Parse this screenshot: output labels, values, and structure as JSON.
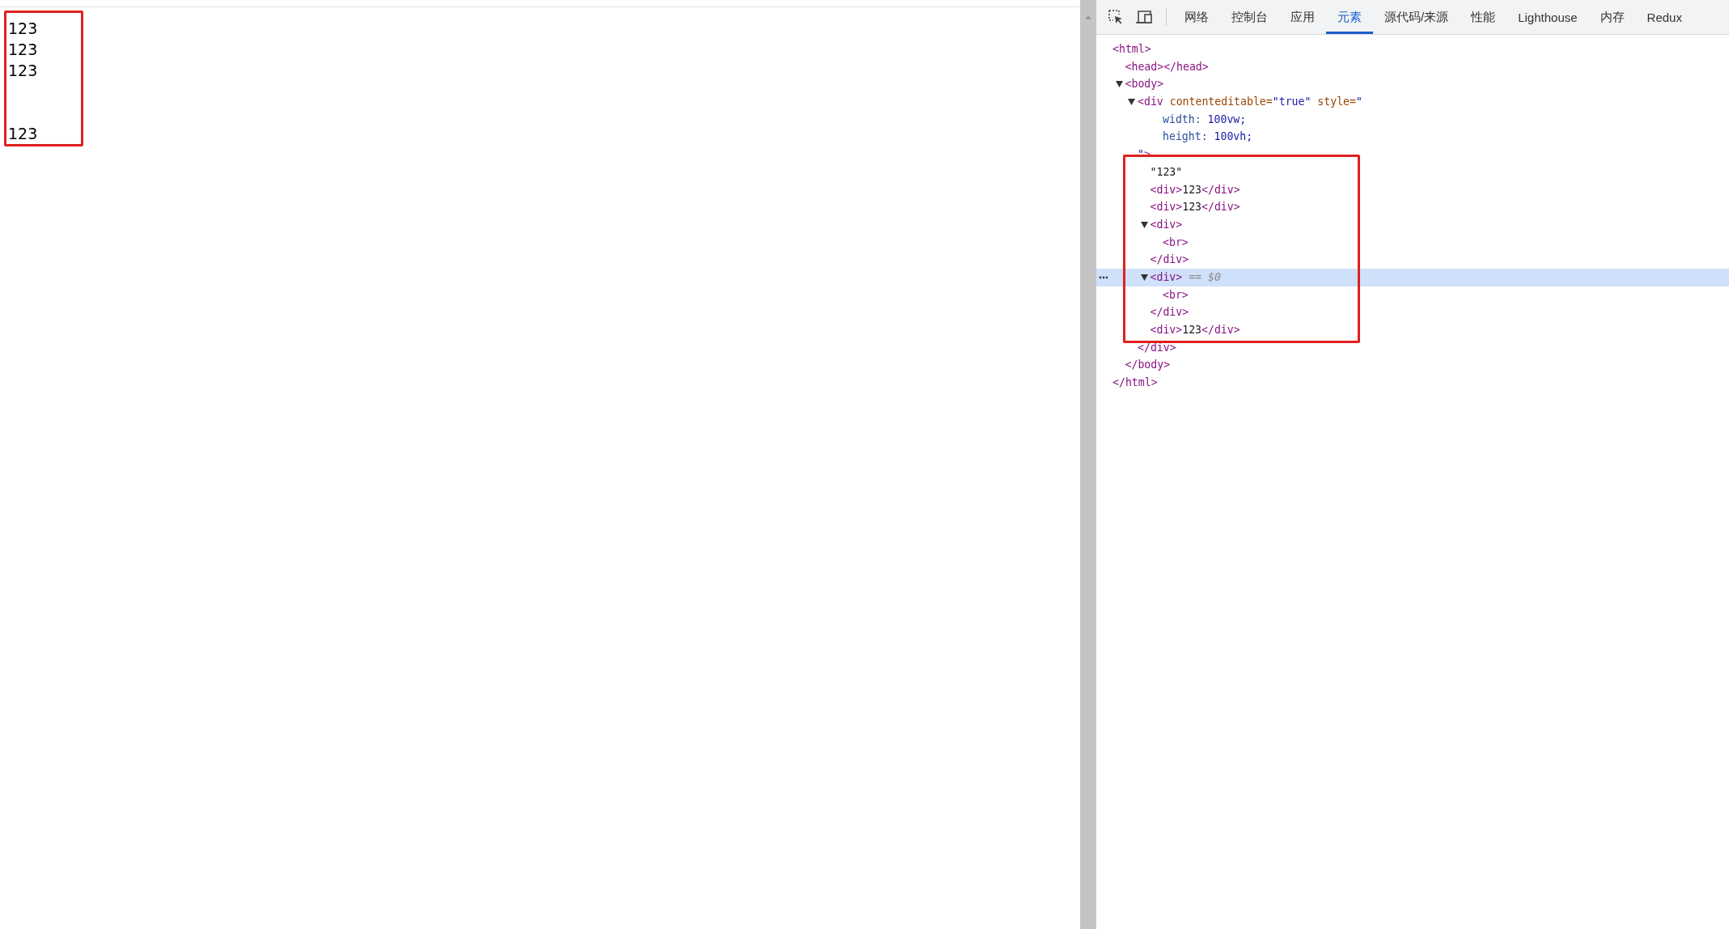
{
  "page": {
    "lines": [
      {
        "kind": "text",
        "text": "123"
      },
      {
        "kind": "text",
        "text": "123"
      },
      {
        "kind": "text",
        "text": "123"
      },
      {
        "kind": "blank"
      },
      {
        "kind": "blank"
      },
      {
        "kind": "text",
        "text": "123"
      }
    ]
  },
  "devtools": {
    "tabs": [
      {
        "label": "网络",
        "selected": false
      },
      {
        "label": "控制台",
        "selected": false
      },
      {
        "label": "应用",
        "selected": false
      },
      {
        "label": "元素",
        "selected": true
      },
      {
        "label": "源代码/来源",
        "selected": false
      },
      {
        "label": "性能",
        "selected": false
      },
      {
        "label": "Lighthouse",
        "selected": false
      },
      {
        "label": "内存",
        "selected": false
      },
      {
        "label": "Redux",
        "selected": false
      }
    ],
    "tree": [
      {
        "selected": false,
        "open": [
          {
            "kind": "tag",
            "text": "<html>"
          }
        ],
        "close": [
          {
            "kind": "tag",
            "text": "</html>"
          }
        ],
        "children": [
          {
            "selected": false,
            "open": [
              {
                "kind": "tag",
                "text": "<head></head>"
              }
            ]
          },
          {
            "selected": false,
            "expanded": true,
            "open": [
              {
                "kind": "tag",
                "text": "<body>"
              }
            ],
            "close": [
              {
                "kind": "tag",
                "text": "</body>"
              }
            ],
            "children": [
              {
                "selected": false,
                "expanded": true,
                "open": [
                  {
                    "kind": "tag",
                    "text": "<div "
                  },
                  {
                    "kind": "attr",
                    "text": "contenteditable="
                  },
                  {
                    "kind": "value",
                    "text": "\"true\" "
                  },
                  {
                    "kind": "attr",
                    "text": "style="
                  },
                  {
                    "kind": "value",
                    "text": "\""
                  }
                ],
                "style_lines": [
                  [
                    {
                      "kind": "prop",
                      "text": "width: "
                    },
                    {
                      "kind": "value",
                      "text": "100vw;"
                    }
                  ],
                  [
                    {
                      "kind": "prop",
                      "text": "height: "
                    },
                    {
                      "kind": "value",
                      "text": "100vh;"
                    }
                  ]
                ],
                "open_end": [
                  {
                    "kind": "value",
                    "text": "\""
                  },
                  {
                    "kind": "tag",
                    "text": ">"
                  }
                ],
                "close": [
                  {
                    "kind": "tag",
                    "text": "</div>"
                  }
                ],
                "children": [
                  {
                    "selected": false,
                    "open": [
                      {
                        "kind": "text",
                        "text": "\"123\""
                      }
                    ]
                  },
                  {
                    "selected": false,
                    "open": [
                      {
                        "kind": "tag",
                        "text": "<div>"
                      },
                      {
                        "kind": "text",
                        "text": "123"
                      },
                      {
                        "kind": "tag",
                        "text": "</div>"
                      }
                    ]
                  },
                  {
                    "selected": false,
                    "open": [
                      {
                        "kind": "tag",
                        "text": "<div>"
                      },
                      {
                        "kind": "text",
                        "text": "123"
                      },
                      {
                        "kind": "tag",
                        "text": "</div>"
                      }
                    ]
                  },
                  {
                    "selected": false,
                    "expanded": true,
                    "open": [
                      {
                        "kind": "tag",
                        "text": "<div>"
                      }
                    ],
                    "close": [
                      {
                        "kind": "tag",
                        "text": "</div>"
                      }
                    ],
                    "children": [
                      {
                        "selected": false,
                        "open": [
                          {
                            "kind": "tag",
                            "text": "<br>"
                          }
                        ]
                      }
                    ]
                  },
                  {
                    "selected": true,
                    "expanded": true,
                    "open": [
                      {
                        "kind": "tag",
                        "text": "<div>"
                      },
                      {
                        "kind": "badge",
                        "text": " == $0"
                      }
                    ],
                    "close": [
                      {
                        "kind": "tag",
                        "text": "</div>"
                      }
                    ],
                    "children": [
                      {
                        "selected": false,
                        "open": [
                          {
                            "kind": "tag",
                            "text": "<br>"
                          }
                        ]
                      }
                    ]
                  },
                  {
                    "selected": false,
                    "open": [
                      {
                        "kind": "tag",
                        "text": "<div>"
                      },
                      {
                        "kind": "text",
                        "text": "123"
                      },
                      {
                        "kind": "tag",
                        "text": "</div>"
                      }
                    ]
                  }
                ]
              }
            ]
          }
        ]
      }
    ]
  }
}
